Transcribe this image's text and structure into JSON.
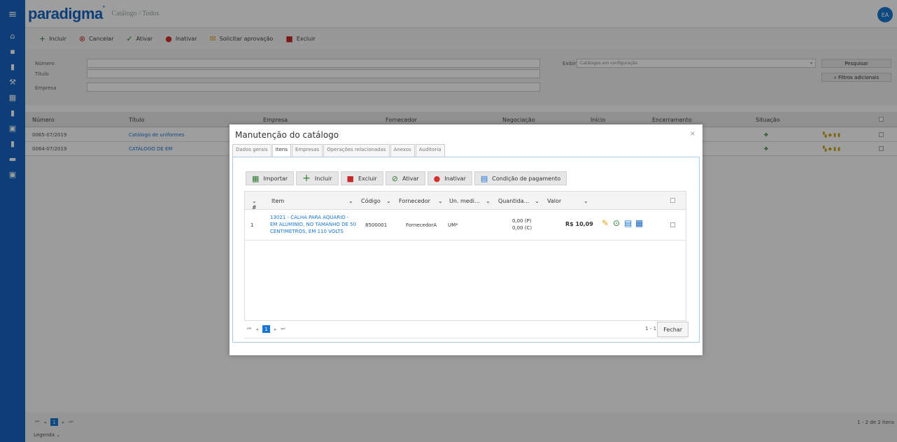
{
  "app": {
    "logo": "paradigma",
    "logo_mark": "°",
    "breadcrumb": "Catálogo / Todos",
    "user_initials": "EA"
  },
  "toolbar": {
    "incluir": "Incluir",
    "cancelar": "Cancelar",
    "ativar": "Ativar",
    "inativar": "Inativar",
    "solicitar": "Solicitar aprovação",
    "excluir": "Excluir"
  },
  "filters": {
    "numero": "Número",
    "titulo": "Título",
    "empresa": "Empresa",
    "exibir_label": "Exibir",
    "exibir_value": "Catálogos em configuração",
    "pesquisar": "Pesquisar",
    "filtros": "Filtros adicionais"
  },
  "grid": {
    "headers": [
      "Número",
      "Título",
      "Empresa",
      "Fornecedor",
      "Negociação",
      "Início",
      "Encerramento",
      "Situação"
    ],
    "rows": [
      {
        "numero": "0065-07/2019",
        "titulo": "Catálogo de uniformes"
      },
      {
        "numero": "0064-07/2019",
        "titulo": "CATÁLOGO DE EM"
      }
    ],
    "page": "1",
    "count": "1 - 2 de 2 itens",
    "legenda": "Legenda"
  },
  "modal": {
    "title": "Manutenção do catálogo",
    "close": "×",
    "tabs": [
      "Dados gerais",
      "Itens",
      "Empresas",
      "Operações relacionadas",
      "Anexos",
      "Auditoria"
    ],
    "actions": {
      "importar": "Importar",
      "incluir": "Incluir",
      "excluir": "Excluir",
      "ativar": "Ativar",
      "inativar": "Inativar",
      "condicao": "Condição de pagamento"
    },
    "columns": [
      "#",
      "Item",
      "Código",
      "Fornecedor",
      "Un. medi...",
      "Quantida...",
      "Valor"
    ],
    "row": {
      "num": "1",
      "item": "13021 - CALHA PARA AQUARIO - EM ALUMINIO, NO TAMANHO DE 50 CENTIMETROS, EM 110 VOLTS",
      "codigo": "8500001",
      "fornecedor": "FornecedorA",
      "unidade": "UM*",
      "qtd_p": "0,00 (P)",
      "qtd_c": "0,00 (C)",
      "valor": "R$ 10,09"
    },
    "page": "1",
    "count": "1 - 1 de 1 itens",
    "fechar": "Fechar"
  }
}
